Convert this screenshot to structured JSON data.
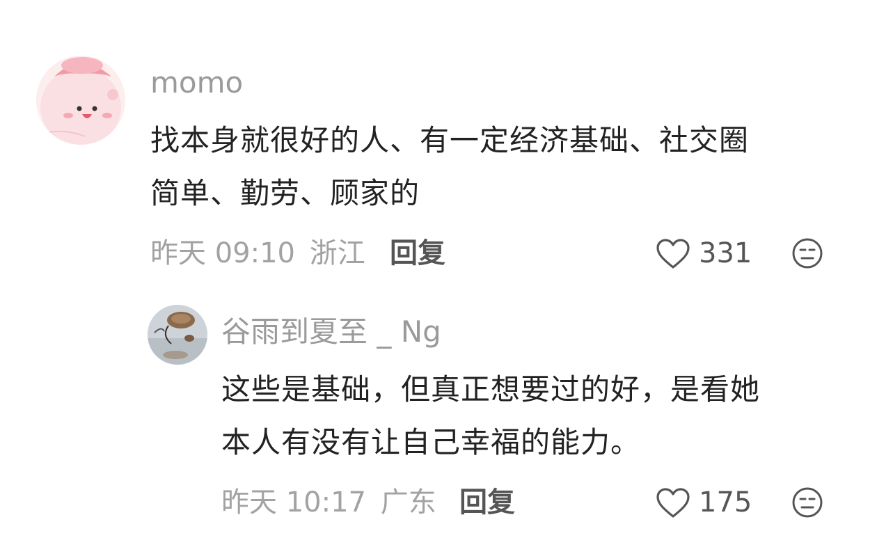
{
  "comments": [
    {
      "username": "momo",
      "text_lines": [
        "找本身就很好的人、有一定经济基础、社交圈",
        "简单、勤劳、顾家的"
      ],
      "time": "昨天 09:10",
      "location": "浙江",
      "reply_label": "回复",
      "likes": "331",
      "avatar_icon": "pink-cartoon-avatar",
      "like_icon": "heart-outline-icon",
      "dislike_icon": "unamused-face-icon"
    },
    {
      "username": "谷雨到夏至 _ Ng",
      "text_lines": [
        "这些是基础，但真正想要过的好，是看她",
        "本人有没有让自己幸福的能力。"
      ],
      "time": "昨天 10:17",
      "location": "广东",
      "reply_label": "回复",
      "likes": "175",
      "avatar_icon": "lotus-leaf-photo-avatar",
      "like_icon": "heart-outline-icon",
      "dislike_icon": "unamused-face-icon"
    }
  ],
  "colors": {
    "username": "#9a9a9a",
    "body_text": "#222222",
    "meta_text": "#a2a2a2",
    "action_text": "#555555"
  }
}
